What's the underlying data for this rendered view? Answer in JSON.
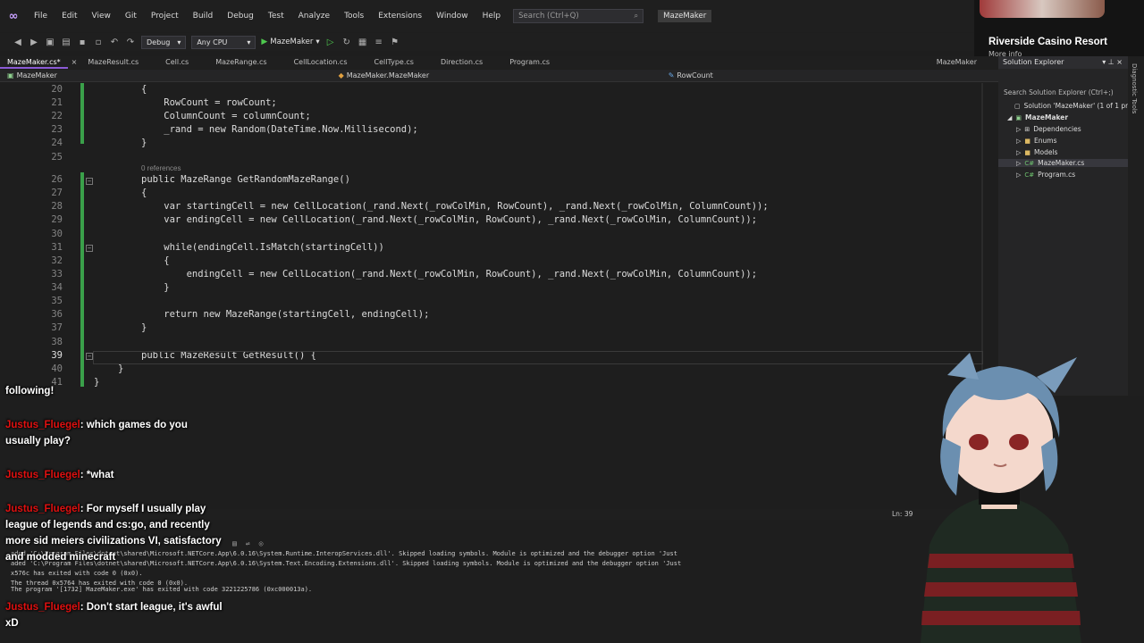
{
  "menubar": {
    "items": [
      "File",
      "Edit",
      "View",
      "Git",
      "Project",
      "Build",
      "Debug",
      "Test",
      "Analyze",
      "Tools",
      "Extensions",
      "Window",
      "Help"
    ],
    "search_placeholder": "Search (Ctrl+Q)",
    "solution_badge": "MazeMaker"
  },
  "toolbar": {
    "config": "Debug",
    "platform": "Any CPU",
    "start_target": "MazeMaker"
  },
  "tabs": {
    "items": [
      "MazeMaker.cs*",
      "MazeResult.cs",
      "Cell.cs",
      "MazeRange.cs",
      "CellLocation.cs",
      "CellType.cs",
      "Direction.cs",
      "Program.cs"
    ],
    "right_label": "MazeMaker"
  },
  "navbar": {
    "project": "MazeMaker",
    "type": "MazeMaker.MazeMaker",
    "member": "RowCount"
  },
  "editor": {
    "refs_label": "0 references",
    "lines": [
      {
        "n": "20",
        "text": "{"
      },
      {
        "n": "21",
        "text": "    RowCount = rowCount;"
      },
      {
        "n": "22",
        "text": "    ColumnCount = columnCount;"
      },
      {
        "n": "23",
        "text": "    _rand = new Random(DateTime.Now.Millisecond);"
      },
      {
        "n": "24",
        "text": "}"
      },
      {
        "n": "25",
        "text": ""
      },
      {
        "n": "26",
        "text": "public MazeRange GetRandomMazeRange()"
      },
      {
        "n": "27",
        "text": "{"
      },
      {
        "n": "28",
        "text": "    var startingCell = new CellLocation(_rand.Next(_rowColMin, RowCount), _rand.Next(_rowColMin, ColumnCount));"
      },
      {
        "n": "29",
        "text": "    var endingCell = new CellLocation(_rand.Next(_rowColMin, RowCount), _rand.Next(_rowColMin, ColumnCount));"
      },
      {
        "n": "30",
        "text": ""
      },
      {
        "n": "31",
        "text": "    while(endingCell.IsMatch(startingCell))"
      },
      {
        "n": "32",
        "text": "    {"
      },
      {
        "n": "33",
        "text": "        endingCell = new CellLocation(_rand.Next(_rowColMin, RowCount), _rand.Next(_rowColMin, ColumnCount));"
      },
      {
        "n": "34",
        "text": "    }"
      },
      {
        "n": "35",
        "text": ""
      },
      {
        "n": "36",
        "text": "    return new MazeRange(startingCell, endingCell);"
      },
      {
        "n": "37",
        "text": "}"
      },
      {
        "n": "38",
        "text": ""
      },
      {
        "n": "39",
        "text": "public MazeResult GetResult() {"
      },
      {
        "n": "40",
        "text": "}"
      },
      {
        "n": "41",
        "text": "}"
      }
    ],
    "status_position": "Ln: 39"
  },
  "output": {
    "lines": [
      "aded 'C:\\Program Files\\dotnet\\shared\\Microsoft.NETCore.App\\6.0.16\\System.Runtime.InteropServices.dll'. Skipped loading symbols. Module is optimized and the debugger option 'Just",
      "aded 'C:\\Program Files\\dotnet\\shared\\Microsoft.NETCore.App\\6.0.16\\System.Text.Encoding.Extensions.dll'. Skipped loading symbols. Module is optimized and the debugger option 'Just",
      "x576c has exited with code 0 (0x0).",
      "The thread 0x5764 has exited with code 0 (0x0).",
      "The program '[1732] MazeMaker.exe' has exited with code 3221225786 (0xc000013a)."
    ]
  },
  "solution_explorer": {
    "title": "Solution Explorer",
    "search_placeholder": "Search Solution Explorer (Ctrl+;)",
    "items": [
      {
        "label": "Solution 'MazeMaker' (1 of 1 proj",
        "icon": "solution-icon"
      },
      {
        "label": "MazeMaker",
        "icon": "csproj-icon"
      },
      {
        "label": "Dependencies",
        "icon": "dependencies-icon"
      },
      {
        "label": "Enums",
        "icon": "folder-icon"
      },
      {
        "label": "Models",
        "icon": "folder-icon"
      },
      {
        "label": "MazeMaker.cs",
        "icon": "csharp-file-icon"
      },
      {
        "label": "Program.cs",
        "icon": "csharp-file-icon"
      }
    ],
    "side_tab": "Diagnostic Tools"
  },
  "banner": {
    "title": "Riverside Casino Resort",
    "subtitle": "More info"
  },
  "chat": {
    "messages": [
      {
        "user": "",
        "text": "following!"
      },
      {
        "user": "Justus_Fluegel",
        "text": ": which games do you usually play?"
      },
      {
        "user": "Justus_Fluegel",
        "text": ": *what"
      },
      {
        "user": "Justus_Fluegel",
        "text": ": For myself I usually play league of legends and cs:go, and recently more sid meiers civilizations VI, satisfactory and modded minecraft"
      },
      {
        "user": "Justus_Fluegel",
        "text": ": Don't start league, it's awful xD"
      }
    ]
  }
}
